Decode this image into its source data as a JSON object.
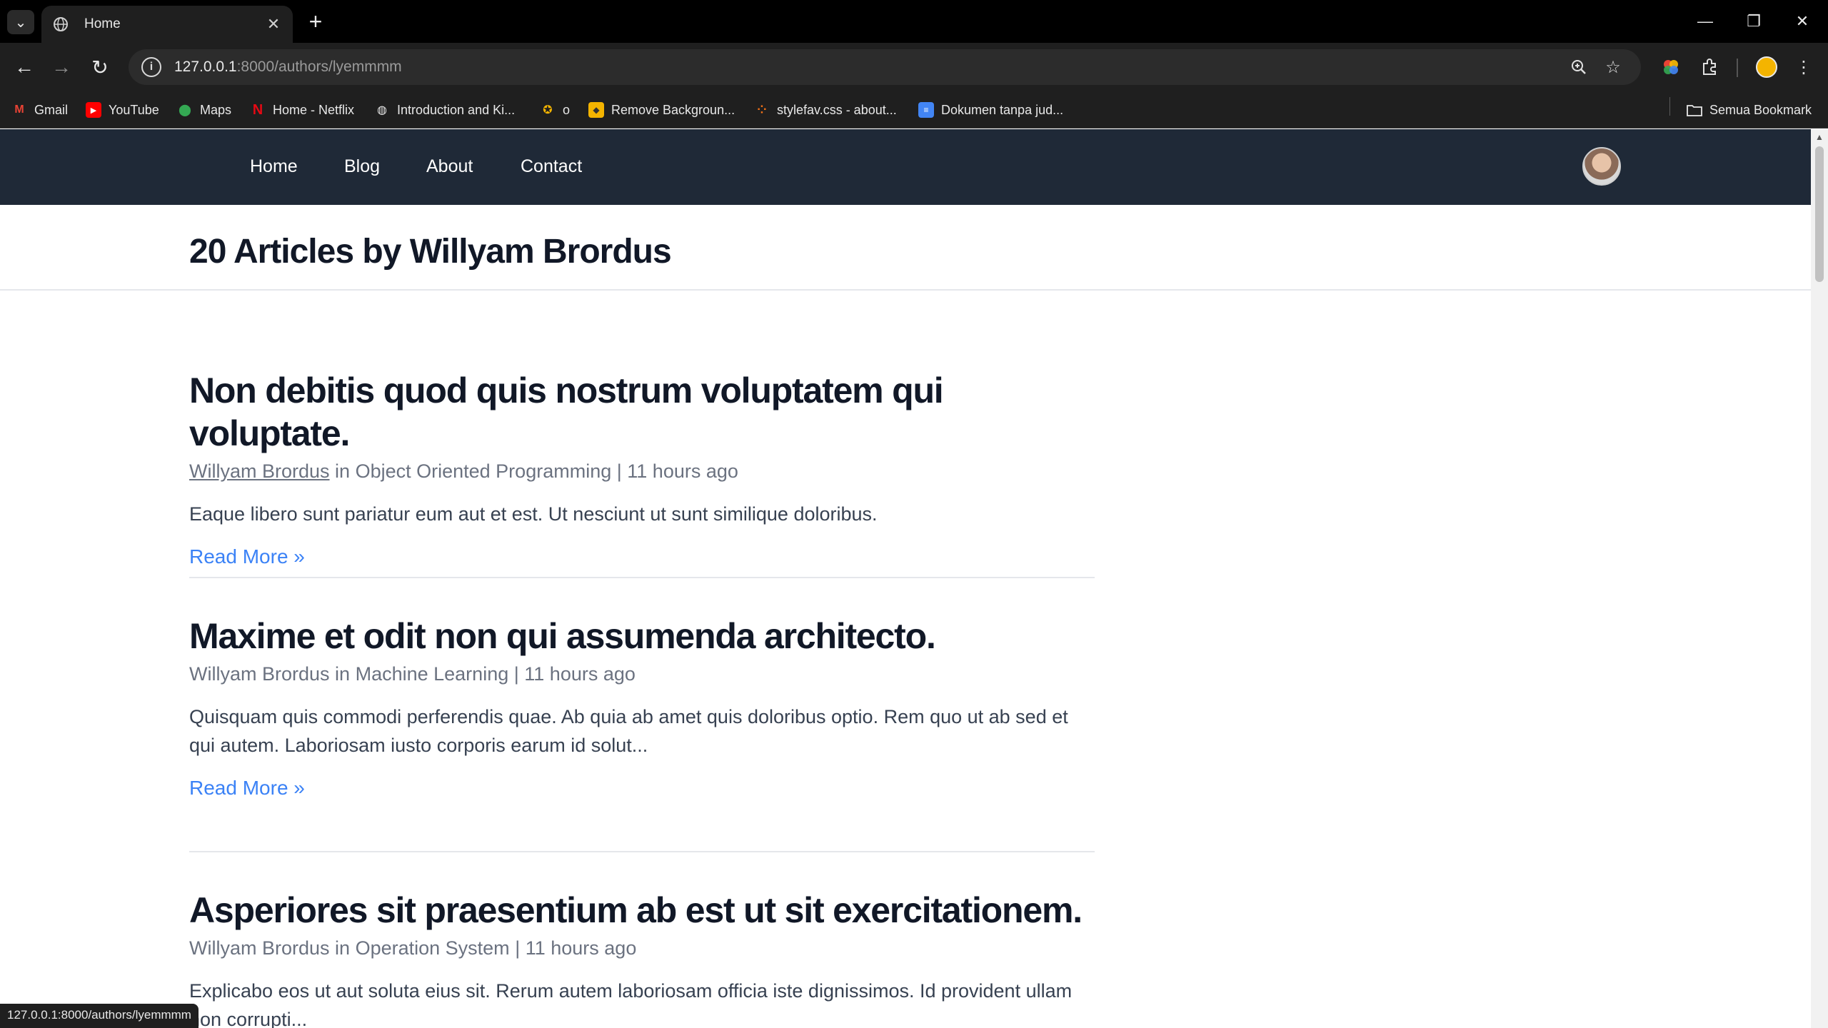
{
  "browser": {
    "tab_title": "Home",
    "url_host": "127.0.0.1",
    "url_rest": ":8000/authors/lyemmmm",
    "status_url": "127.0.0.1:8000/authors/lyemmmm",
    "bookmarks": [
      {
        "label": "Gmail",
        "icon": "gmail-icon"
      },
      {
        "label": "YouTube",
        "icon": "youtube-icon"
      },
      {
        "label": "Maps",
        "icon": "maps-icon"
      },
      {
        "label": "Home - Netflix",
        "icon": "netflix-icon"
      },
      {
        "label": "Introduction and Ki...",
        "icon": "globe-icon"
      },
      {
        "label": "o",
        "icon": "site-icon"
      },
      {
        "label": "Remove Backgroun...",
        "icon": "remove-bg-icon"
      },
      {
        "label": "stylefav.css - about...",
        "icon": "code-icon"
      },
      {
        "label": "Dokumen tanpa jud...",
        "icon": "docs-icon"
      }
    ],
    "all_bookmarks": "Semua Bookmark"
  },
  "nav": {
    "links": [
      "Home",
      "Blog",
      "About",
      "Contact"
    ]
  },
  "author_page": {
    "heading": "20 Articles by Willyam Brordus"
  },
  "posts": [
    {
      "title": "Non debitis quod quis nostrum voluptatem qui voluptate.",
      "author": "Willyam Brordus",
      "in": "in",
      "category": "Object Oriented Programming",
      "sep": "|",
      "time": "11 hours ago",
      "excerpt": "Eaque libero sunt pariatur eum aut et est. Ut nesciunt ut sunt similique doloribus.",
      "read_more": "Read More »"
    },
    {
      "title": "Maxime et odit non qui assumenda architecto.",
      "author": "Willyam Brordus",
      "in": "in",
      "category": "Machine Learning",
      "sep": "|",
      "time": "11 hours ago",
      "excerpt": "Quisquam quis commodi perferendis quae. Ab quia ab amet quis doloribus optio. Rem quo ut ab sed et qui autem. Laboriosam iusto corporis earum id solut...",
      "read_more": "Read More »"
    },
    {
      "title": "Asperiores sit praesentium ab est ut sit exercitationem.",
      "author": "Willyam Brordus",
      "in": "in",
      "category": "Operation System",
      "sep": "|",
      "time": "11 hours ago",
      "excerpt": "Explicabo eos ut aut soluta eius sit. Rerum autem laboriosam officia iste dignissimos. Id provident ullam non corrupti..."
    }
  ],
  "colors": {
    "nav_bg": "#1f2937",
    "link": "#3b82f6",
    "heading": "#111827",
    "meta": "#6b7280"
  }
}
